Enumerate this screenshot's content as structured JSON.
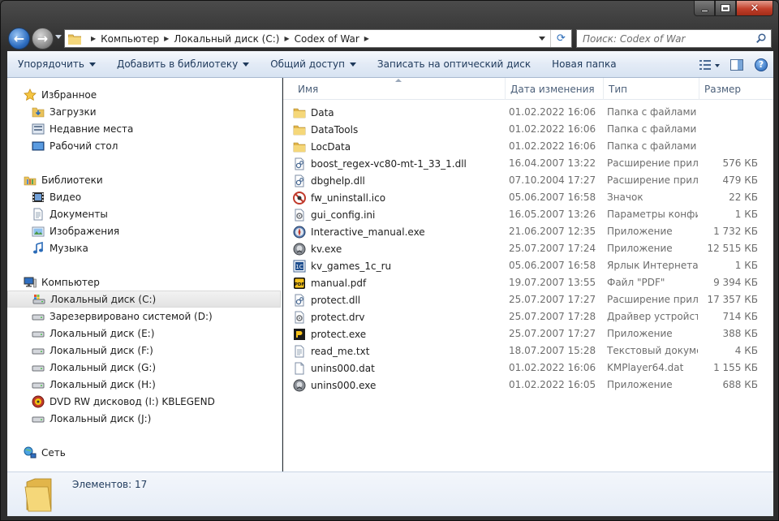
{
  "address": {
    "crumbs": [
      "Компьютер",
      "Локальный диск (C:)",
      "Codex of War"
    ]
  },
  "search": {
    "placeholder": "Поиск: Codex of War"
  },
  "toolbar": {
    "organize": "Упорядочить",
    "add_library": "Добавить в библиотеку",
    "share": "Общий доступ",
    "burn": "Записать на оптический диск",
    "new_folder": "Новая папка"
  },
  "nav": {
    "favorites": "Избранное",
    "downloads": "Загрузки",
    "recent": "Недавние места",
    "desktop": "Рабочий стол",
    "libraries": "Библиотеки",
    "video": "Видео",
    "documents": "Документы",
    "pictures": "Изображения",
    "music": "Музыка",
    "computer": "Компьютер",
    "drives": [
      "Локальный диск (C:)",
      "Зарезервировано системой (D:)",
      "Локальный диск (E:)",
      "Локальный диск (F:)",
      "Локальный диск (G:)",
      "Локальный диск (H:)",
      "DVD RW дисковод (I:) KBLEGEND",
      "Локальный диск (J:)"
    ],
    "network": "Сеть"
  },
  "columns": {
    "name": "Имя",
    "date": "Дата изменения",
    "type": "Тип",
    "size": "Размер"
  },
  "files": [
    {
      "name": "Data",
      "date": "01.02.2022 16:06",
      "type": "Папка с файлами",
      "size": "",
      "icon": "folder"
    },
    {
      "name": "DataTools",
      "date": "01.02.2022 16:06",
      "type": "Папка с файлами",
      "size": "",
      "icon": "folder"
    },
    {
      "name": "LocData",
      "date": "01.02.2022 16:06",
      "type": "Папка с файлами",
      "size": "",
      "icon": "folder"
    },
    {
      "name": "boost_regex-vc80-mt-1_33_1.dll",
      "date": "16.04.2007 13:22",
      "type": "Расширение приложения",
      "size": "576 КБ",
      "icon": "dll"
    },
    {
      "name": "dbghelp.dll",
      "date": "07.10.2004 17:27",
      "type": "Расширение приложения",
      "size": "479 КБ",
      "icon": "dll"
    },
    {
      "name": "fw_uninstall.ico",
      "date": "05.06.2007 16:58",
      "type": "Значок",
      "size": "22 КБ",
      "icon": "ico"
    },
    {
      "name": "gui_config.ini",
      "date": "16.05.2007 13:26",
      "type": "Параметры конфигурации",
      "size": "1 КБ",
      "icon": "ini"
    },
    {
      "name": "Interactive_manual.exe",
      "date": "21.06.2007 12:35",
      "type": "Приложение",
      "size": "1 732 КБ",
      "icon": "exe-compass"
    },
    {
      "name": "kv.exe",
      "date": "25.07.2007 17:24",
      "type": "Приложение",
      "size": "12 515 КБ",
      "icon": "exe-game"
    },
    {
      "name": "kv_games_1c_ru",
      "date": "05.06.2007 16:58",
      "type": "Ярлык Интернета",
      "size": "1 КБ",
      "icon": "url"
    },
    {
      "name": "manual.pdf",
      "date": "19.07.2007 13:55",
      "type": "Файл \"PDF\"",
      "size": "9 394 КБ",
      "icon": "pdf"
    },
    {
      "name": "protect.dll",
      "date": "25.07.2007 17:27",
      "type": "Расширение приложения",
      "size": "17 357 КБ",
      "icon": "dll"
    },
    {
      "name": "protect.drv",
      "date": "25.07.2007 17:28",
      "type": "Драйвер устройства",
      "size": "714 КБ",
      "icon": "drv"
    },
    {
      "name": "protect.exe",
      "date": "25.07.2007 17:27",
      "type": "Приложение",
      "size": "388 КБ",
      "icon": "exe-protect"
    },
    {
      "name": "read_me.txt",
      "date": "18.07.2007 15:28",
      "type": "Текстовый документ",
      "size": "4 КБ",
      "icon": "txt"
    },
    {
      "name": "unins000.dat",
      "date": "01.02.2022 16:06",
      "type": "KMPlayer64.dat",
      "size": "1 155 КБ",
      "icon": "dat"
    },
    {
      "name": "unins000.exe",
      "date": "01.02.2022 16:05",
      "type": "Приложение",
      "size": "688 КБ",
      "icon": "exe-game"
    }
  ],
  "status": {
    "count": "Элементов: 17"
  }
}
